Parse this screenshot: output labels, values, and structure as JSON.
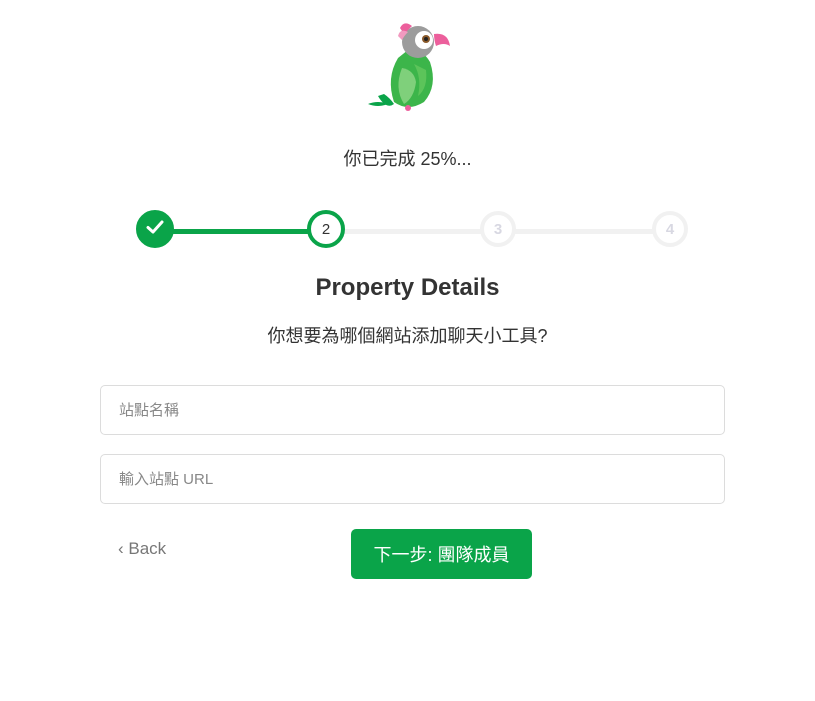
{
  "header": {
    "logo_icon": "parrot-mascot-icon",
    "progress_text": "你已完成 25%..."
  },
  "stepper": {
    "steps": [
      {
        "label": "✓",
        "state": "complete"
      },
      {
        "label": "2",
        "state": "current"
      },
      {
        "label": "3",
        "state": "pending"
      },
      {
        "label": "4",
        "state": "pending"
      }
    ]
  },
  "form": {
    "title": "Property Details",
    "question": "你想要為哪個網站添加聊天小工具?",
    "site_name": {
      "value": "",
      "placeholder": "站點名稱"
    },
    "site_url": {
      "value": "",
      "placeholder": "輸入站點 URL"
    }
  },
  "actions": {
    "back_label": "‹ Back",
    "next_label": "下一步: 團隊成員"
  },
  "colors": {
    "accent": "#0aa449",
    "pending": "#f1f1f1",
    "text": "#333333"
  }
}
